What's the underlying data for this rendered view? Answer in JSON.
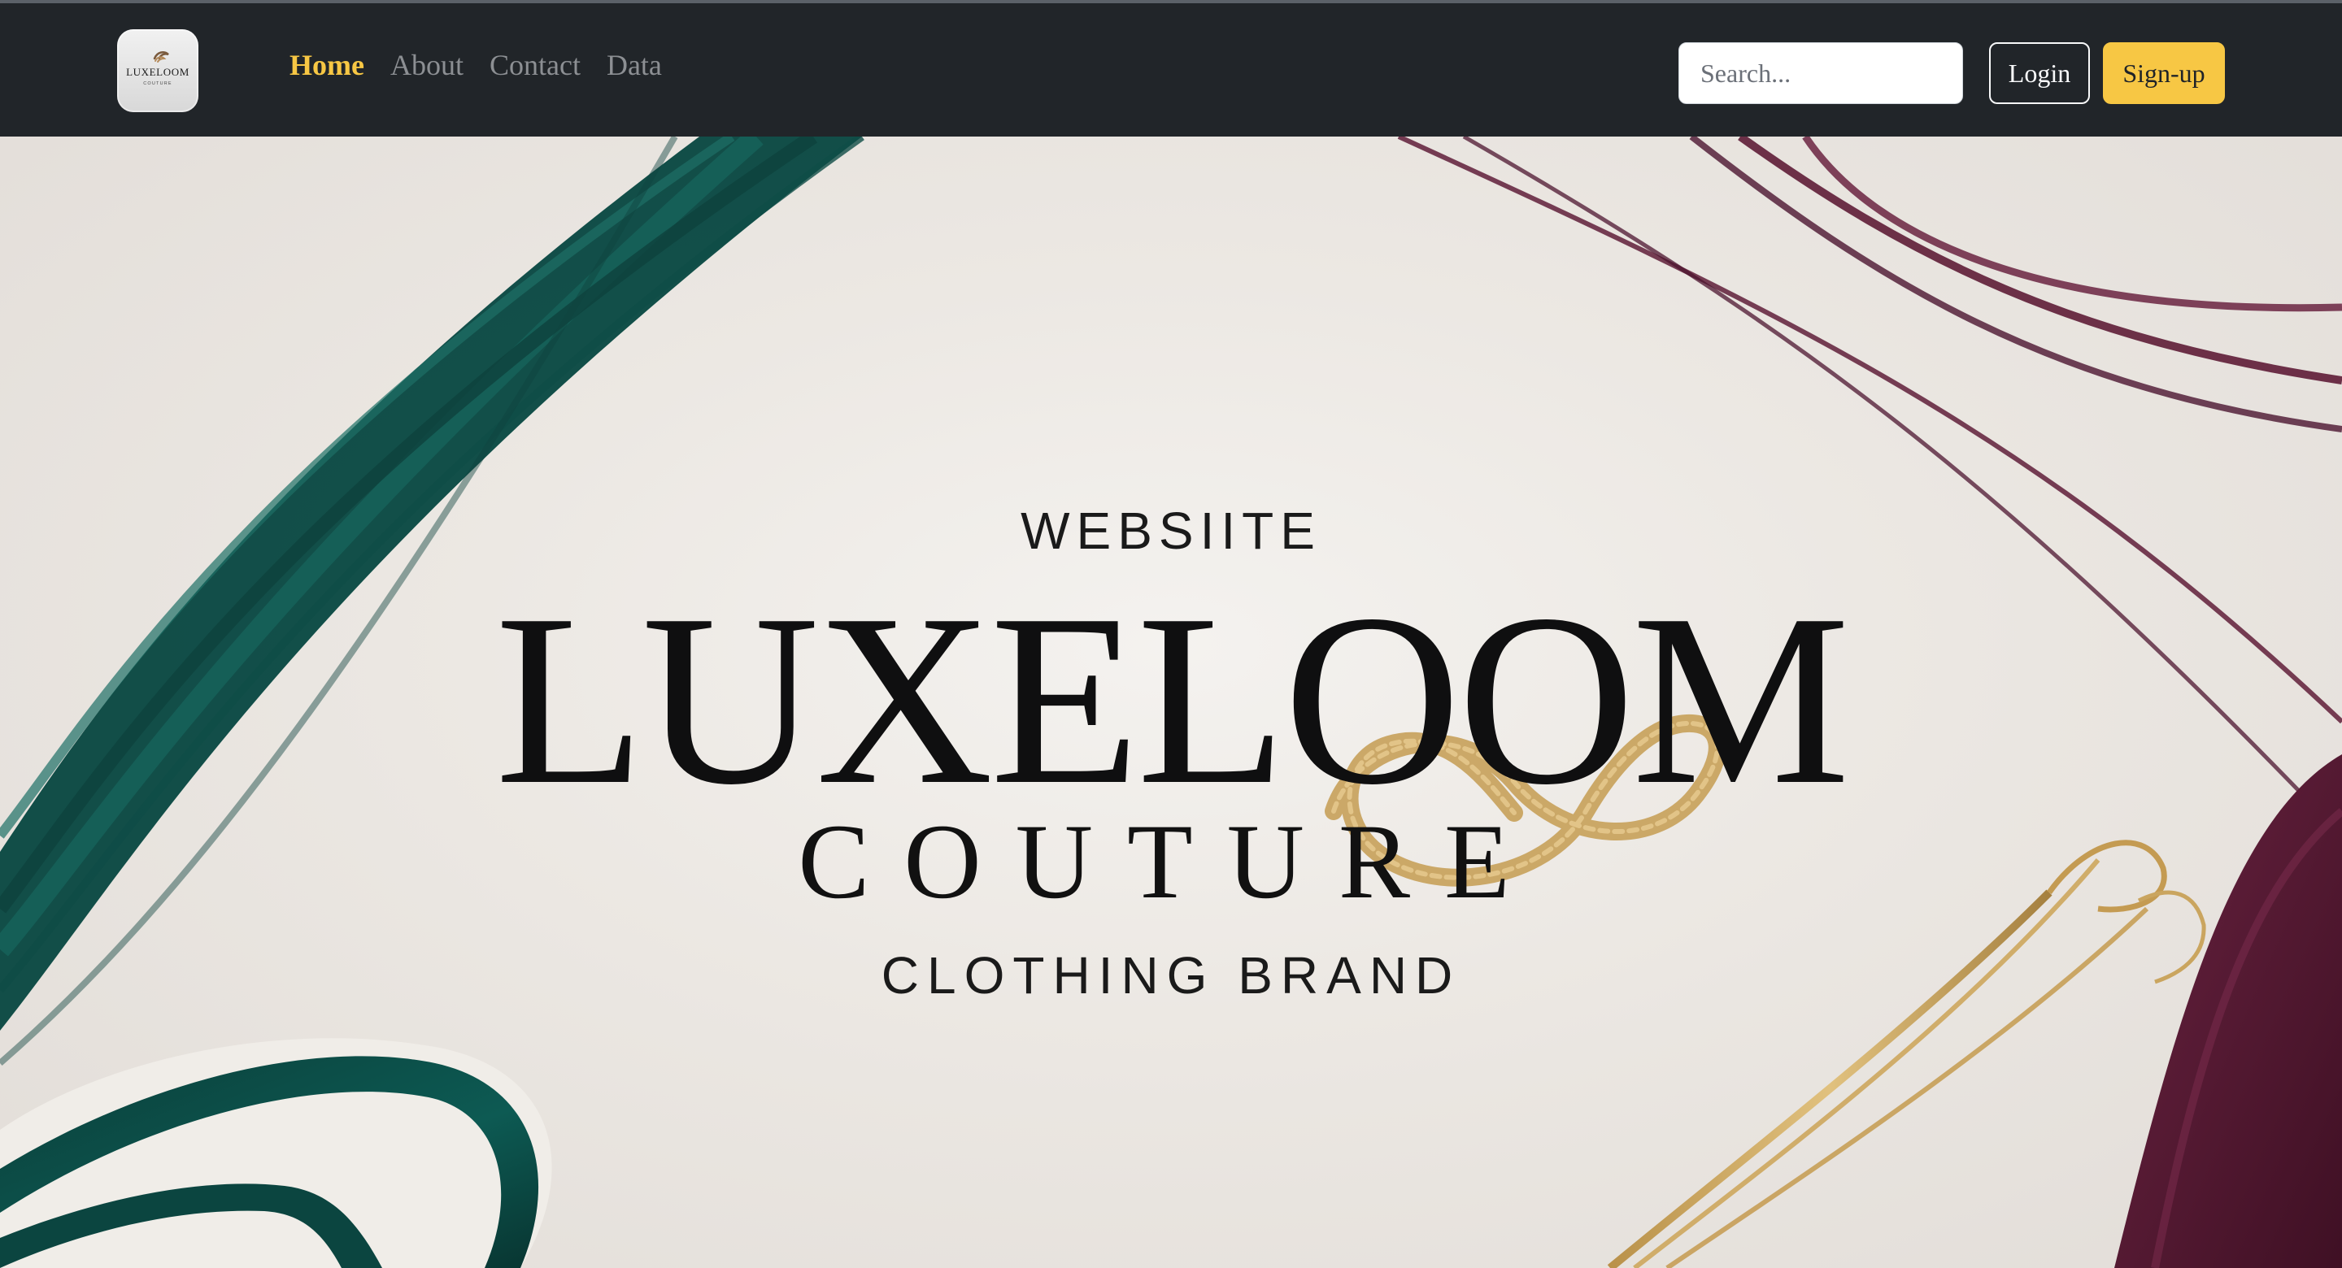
{
  "navbar": {
    "logo": {
      "name": "LUXELOOM",
      "tag": "COUTURE"
    },
    "links": [
      {
        "label": "Home",
        "active": true
      },
      {
        "label": "About",
        "active": false
      },
      {
        "label": "Contact",
        "active": false
      },
      {
        "label": "Data",
        "active": false
      }
    ],
    "search": {
      "placeholder": "Search...",
      "value": ""
    },
    "buttons": {
      "login": "Login",
      "signup": "Sign-up"
    }
  },
  "hero": {
    "kicker": "WEBSIITE",
    "title": "LUXELOOM",
    "subtitle": "COUTURE",
    "tagline": "CLOTHING BRAND",
    "colors": {
      "navbar_bg": "#212529",
      "accent": "#f7c744",
      "hero_bg": "#ece8e3",
      "thread_green": "#0e4b45",
      "thread_maroon": "#561b30",
      "thread_gold": "#c8a25c"
    }
  }
}
